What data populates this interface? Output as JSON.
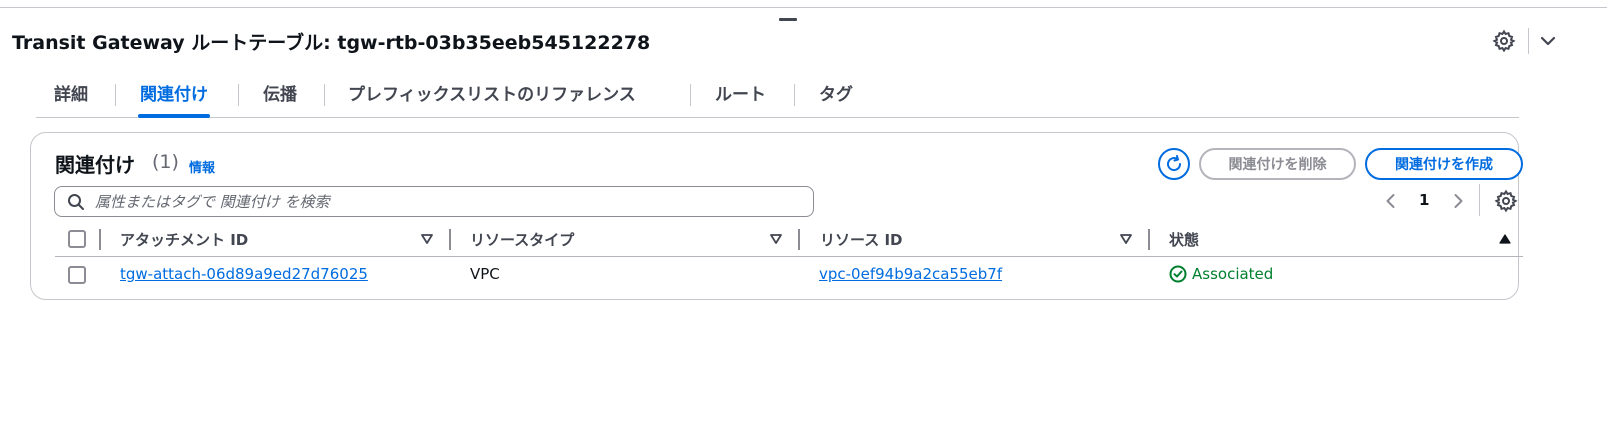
{
  "header": {
    "title": "Transit Gateway ルートテーブル: tgw-rtb-03b35eeb545122278",
    "settings_icon": "gear-icon",
    "collapse_icon": "chevron-down-icon"
  },
  "tabs": [
    {
      "label": "詳細"
    },
    {
      "label": "関連付け",
      "active": true
    },
    {
      "label": "伝播"
    },
    {
      "label": "プレフィックスリストのリファレンス"
    },
    {
      "label": "ルート"
    },
    {
      "label": "タグ"
    }
  ],
  "panel": {
    "title": "関連付け",
    "count": "(1)",
    "info_link": "情報",
    "refresh_icon": "refresh-icon",
    "delete_button": "関連付けを削除",
    "create_button": "関連付けを作成",
    "search": {
      "placeholder": "属性またはタグで 関連付け を検索",
      "value": ""
    },
    "pagination": {
      "current_page": "1"
    },
    "columns": [
      {
        "label": "アタッチメント ID",
        "sort": "descending"
      },
      {
        "label": "リソースタイプ",
        "sort": "descending"
      },
      {
        "label": "リソース ID",
        "sort": "descending"
      },
      {
        "label": "状態",
        "sort": "ascending"
      }
    ],
    "rows": [
      {
        "attachment_id": "tgw-attach-06d89a9ed27d76025",
        "resource_type": "VPC",
        "resource_id": "vpc-0ef94b9a2ca55eb7f",
        "state": "Associated"
      }
    ]
  },
  "colors": {
    "accent": "#006ce0",
    "success": "#00802f",
    "text": "#0f141a",
    "muted": "#424650",
    "border": "#c6c6cd"
  }
}
